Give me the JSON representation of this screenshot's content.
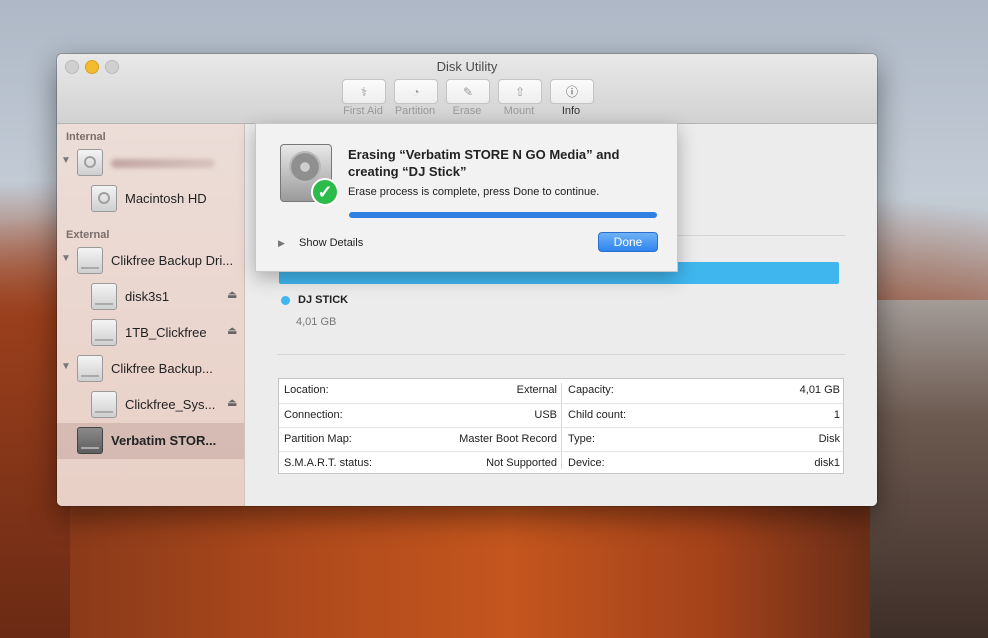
{
  "window": {
    "title": "Disk Utility"
  },
  "toolbar": {
    "items": [
      {
        "label": "First Aid",
        "icon": "stethoscope-icon"
      },
      {
        "label": "Partition",
        "icon": "pie-icon"
      },
      {
        "label": "Erase",
        "icon": "erase-icon"
      },
      {
        "label": "Mount",
        "icon": "mount-icon"
      },
      {
        "label": "Info",
        "icon": "info-icon"
      }
    ]
  },
  "sidebar": {
    "internal_header": "Internal",
    "internal_item": "Macintosh HD",
    "external_header": "External",
    "items": [
      {
        "label": "Clikfree Backup Dri...",
        "icon": "external-disk-icon"
      },
      {
        "label": "disk3s1",
        "icon": "volume-icon"
      },
      {
        "label": "1TB_Clickfree",
        "icon": "volume-icon"
      },
      {
        "label": "Clikfree Backup...",
        "icon": "external-disk-icon"
      },
      {
        "label": "Clickfree_Sys...",
        "icon": "volume-icon"
      },
      {
        "label": "Verbatim STOR...",
        "icon": "external-disk-icon"
      }
    ]
  },
  "main": {
    "volume_name": "DJ STICK",
    "volume_size": "4,01 GB",
    "info": {
      "left": [
        {
          "key": "Location:",
          "value": "External"
        },
        {
          "key": "Connection:",
          "value": "USB"
        },
        {
          "key": "Partition Map:",
          "value": "Master Boot Record"
        },
        {
          "key": "S.M.A.R.T. status:",
          "value": "Not Supported"
        }
      ],
      "right": [
        {
          "key": "Capacity:",
          "value": "4,01 GB"
        },
        {
          "key": "Child count:",
          "value": "1"
        },
        {
          "key": "Type:",
          "value": "Disk"
        },
        {
          "key": "Device:",
          "value": "disk1"
        }
      ]
    }
  },
  "sheet": {
    "title": "Erasing “Verbatim STORE N GO Media” and creating “DJ Stick”",
    "message": "Erase process is complete, press Done to continue.",
    "progress": 1.0,
    "details_label": "Show Details",
    "done_label": "Done"
  },
  "colors": {
    "accent": "#2f80e0",
    "usage": "#3fb6ee",
    "success": "#2dbb4c"
  }
}
